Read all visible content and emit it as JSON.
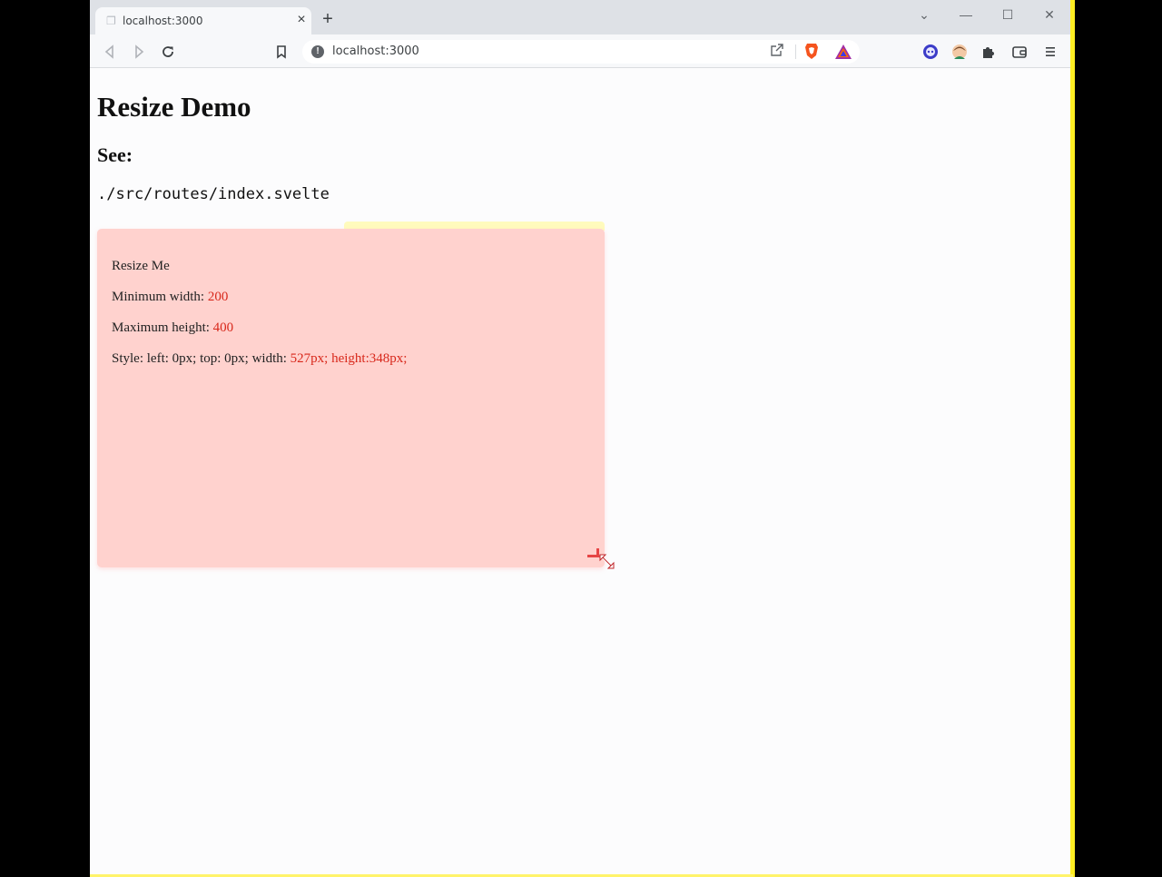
{
  "browser": {
    "tab_title": "localhost:3000",
    "tab_close": "×",
    "new_tab": "+",
    "url": "localhost:3000",
    "window_controls": {
      "dropdown": "⌄",
      "minimize": "—",
      "maximize": "☐",
      "close": "✕"
    },
    "toolbar_icons": [
      "back-icon",
      "forward-icon",
      "reload-icon",
      "bookmark-icon",
      "share-icon",
      "brave-shield-icon",
      "brave-rewards-icon",
      "extension-avatar-icon",
      "profile-avatar-icon",
      "puzzle-extensions-icon",
      "wallet-icon",
      "menu-icon"
    ]
  },
  "page": {
    "heading": "Resize Demo",
    "subheading": "See:",
    "code_path": "./src/routes/index.svelte",
    "box": {
      "title": "Resize Me",
      "min_width_label": "Minimum width: ",
      "min_width_value": "200",
      "max_height_label": "Maximum height: ",
      "max_height_value": "400",
      "style_prefix": "Style: left: 0px; top: 0px; width: ",
      "style_width": "527",
      "style_mid": "px; height:",
      "style_height": "348",
      "style_suffix": "px;"
    }
  },
  "colors": {
    "box_background": "#ffd2ce",
    "accent_red": "#d8281b",
    "highlight_yellow": "#ffee22"
  }
}
